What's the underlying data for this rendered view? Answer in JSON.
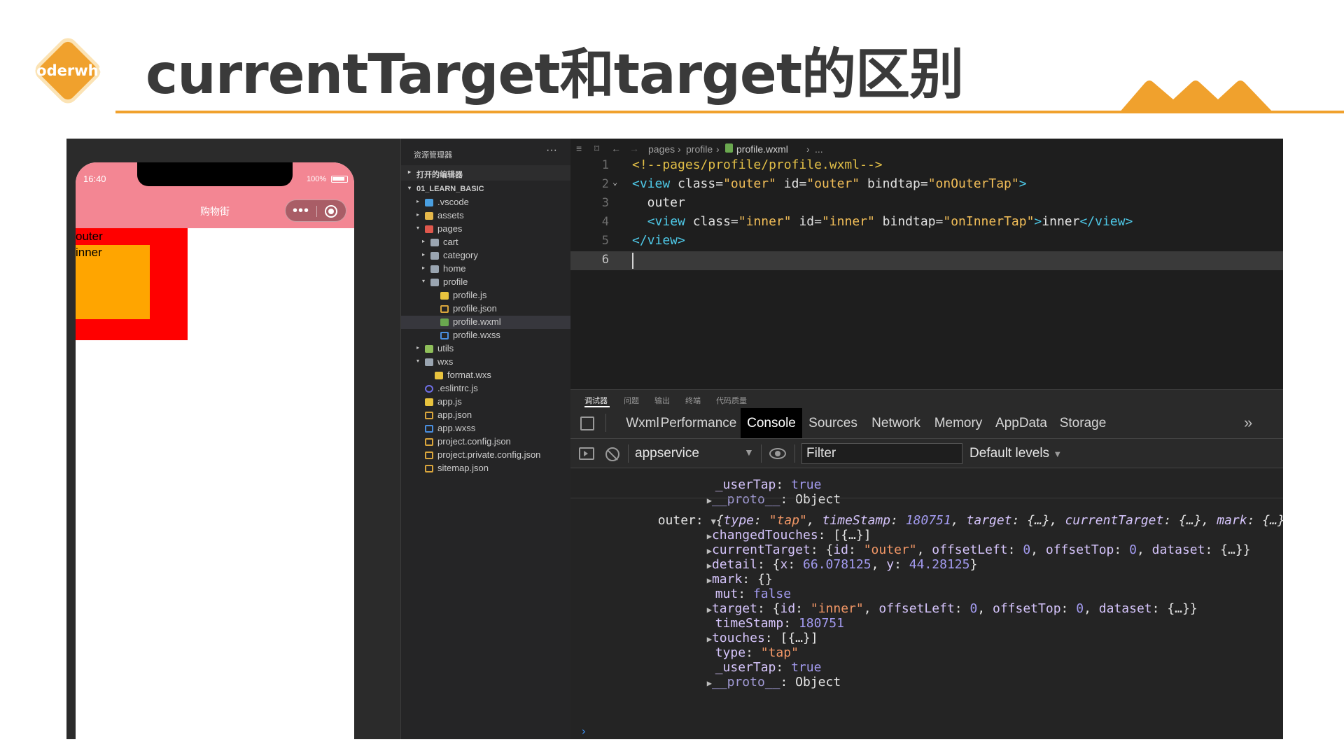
{
  "slide": {
    "logo_text": "coderwhy",
    "title": "currentTarget和target的区别",
    "colors": {
      "accent": "#f0a12d",
      "title": "#3a3a3a"
    }
  },
  "simulator": {
    "time": "16:40",
    "battery": "100%",
    "page_title": "购物街",
    "outer_label": "outer",
    "inner_label": "inner",
    "colors": {
      "nav": "#f38693",
      "outer": "#ff0000",
      "inner": "#ffa500"
    }
  },
  "explorer": {
    "title": "资源管理器",
    "more": "···",
    "open_editors": "打开的编辑器",
    "project": "01_LEARN_BASIC",
    "tree": [
      {
        "label": ".vscode",
        "icon": "folder-vscode-icon",
        "twisty": "▸"
      },
      {
        "label": "assets",
        "icon": "folder-assets-icon",
        "twisty": "▸"
      },
      {
        "label": "pages",
        "icon": "folder-pages-icon",
        "twisty": "▾"
      },
      {
        "label": "cart",
        "icon": "folder-icon",
        "twisty": "▸"
      },
      {
        "label": "category",
        "icon": "folder-icon",
        "twisty": "▸"
      },
      {
        "label": "home",
        "icon": "folder-icon",
        "twisty": "▸"
      },
      {
        "label": "profile",
        "icon": "folder-open-icon",
        "twisty": "▾"
      },
      {
        "label": "profile.js",
        "icon": "js-file-icon",
        "twisty": ""
      },
      {
        "label": "profile.json",
        "icon": "json-file-icon",
        "twisty": ""
      },
      {
        "label": "profile.wxml",
        "icon": "wxml-file-icon",
        "twisty": ""
      },
      {
        "label": "profile.wxss",
        "icon": "wxss-file-icon",
        "twisty": ""
      },
      {
        "label": "utils",
        "icon": "folder-utils-icon",
        "twisty": "▸"
      },
      {
        "label": "wxs",
        "icon": "folder-wxs-icon",
        "twisty": "▾"
      },
      {
        "label": "format.wxs",
        "icon": "js-file-icon",
        "twisty": ""
      },
      {
        "label": ".eslintrc.js",
        "icon": "eslint-file-icon",
        "twisty": ""
      },
      {
        "label": "app.js",
        "icon": "js-file-icon",
        "twisty": ""
      },
      {
        "label": "app.json",
        "icon": "json-file-icon",
        "twisty": ""
      },
      {
        "label": "app.wxss",
        "icon": "wxss-file-icon",
        "twisty": ""
      },
      {
        "label": "project.config.json",
        "icon": "json-file-icon",
        "twisty": ""
      },
      {
        "label": "project.private.config.json",
        "icon": "json-file-icon",
        "twisty": ""
      },
      {
        "label": "sitemap.json",
        "icon": "json-file-icon",
        "twisty": ""
      }
    ]
  },
  "editor": {
    "breadcrumb": [
      "pages",
      "profile",
      "profile.wxml",
      "..."
    ],
    "lines": [
      {
        "n": "1",
        "text": "<!--pages/profile/profile.wxml-->"
      },
      {
        "n": "2",
        "text": "<view class=\"outer\" id=\"outer\" bindtap=\"onOuterTap\">"
      },
      {
        "n": "3",
        "text": "  outer"
      },
      {
        "n": "4",
        "text": "  <view class=\"inner\" id=\"inner\" bindtap=\"onInnerTap\">inner</view>"
      },
      {
        "n": "5",
        "text": "</view>"
      },
      {
        "n": "6",
        "text": ""
      }
    ]
  },
  "debugger": {
    "top_tabs": [
      "调试器",
      "问题",
      "输出",
      "终端",
      "代码质量"
    ],
    "panel_tabs": [
      "Wxml",
      "Performance",
      "Console",
      "Sources",
      "Network",
      "Memory",
      "AppData",
      "Storage"
    ],
    "active_panel": "Console",
    "context": "appservice",
    "filter_placeholder": "Filter",
    "levels": "Default levels",
    "more": "»",
    "prompt": "›",
    "console": {
      "prev_usertap_key": "_userTap",
      "prev_usertap_val": "true",
      "prev_proto_key": "__proto__",
      "prev_proto_val": "Object",
      "log_label": "outer:",
      "summary_type_key": "type",
      "summary_type_val": "\"tap\"",
      "summary_ts_key": "timeStamp",
      "summary_ts_val": "180751",
      "summary_target_key": "target",
      "summary_ct_key": "currentTarget",
      "summary_mark_key": "mark",
      "summary_collapsed": "{…}",
      "summary_tail": "…}",
      "rows": {
        "changedTouches_key": "changedTouches",
        "changedTouches_val": "[{…}]",
        "currentTarget_key": "currentTarget",
        "currentTarget_id": "\"outer\"",
        "detail_key": "detail",
        "detail_x": "66.078125",
        "detail_y": "44.28125",
        "mark_key": "mark",
        "mark_val": "{}",
        "mut_key": "mut",
        "mut_val": "false",
        "target_key": "target",
        "target_id": "\"inner\"",
        "timeStamp_key": "timeStamp",
        "timeStamp_val": "180751",
        "touches_key": "touches",
        "touches_val": "[{…}]",
        "type_key": "type",
        "type_val": "\"tap\"",
        "usertap_key": "_userTap",
        "usertap_val": "true",
        "proto_key": "__proto__",
        "proto_val": "Object",
        "offset_zero": "0",
        "dataset_val": "{…}"
      }
    }
  }
}
